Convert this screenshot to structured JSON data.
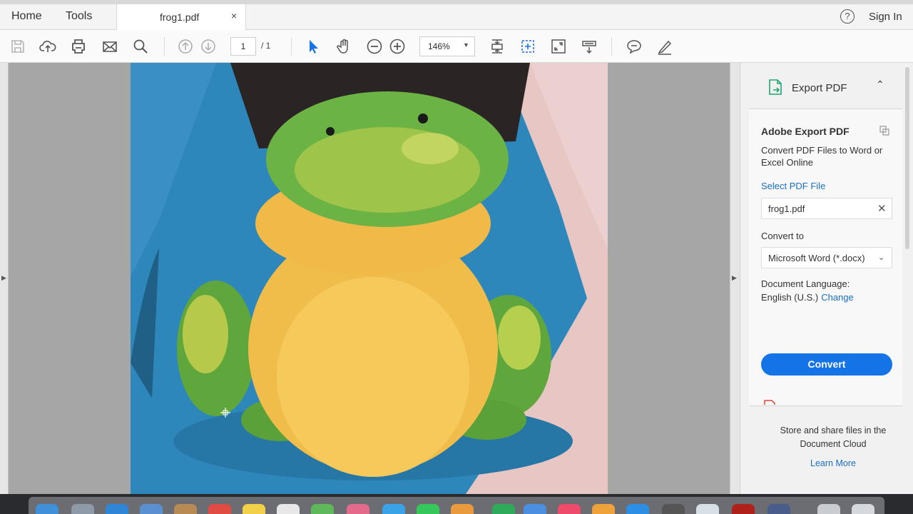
{
  "menubar": {
    "home_label": "Home",
    "tools_label": "Tools",
    "help_glyph": "?",
    "signin_label": "Sign In"
  },
  "tab": {
    "filename": "frog1.pdf",
    "close_glyph": "×"
  },
  "toolbar": {
    "icons": [
      "save-icon",
      "upload-cloud-icon",
      "print-icon",
      "email-icon",
      "search-icon",
      "page-up-icon",
      "page-down-icon",
      "select-arrow-icon",
      "hand-icon",
      "zoom-out-icon",
      "zoom-in-icon",
      "fit-page-icon",
      "marquee-zoom-icon",
      "full-screen-icon",
      "read-mode-icon",
      "comment-icon",
      "sign-icon"
    ],
    "page_current": "1",
    "page_total": "/ 1",
    "zoom": "146%",
    "accent": "#1473e6"
  },
  "document": {
    "content": "photo of a green and yellow plush frog toy on a blue tray"
  },
  "panel": {
    "header_title": "Export PDF",
    "title": "Adobe Export PDF",
    "description": "Convert PDF Files to Word or Excel Online",
    "select_file_label": "Select PDF File",
    "file_value": "frog1.pdf",
    "convert_to_label": "Convert to",
    "convert_to_value": "Microsoft Word (*.docx)",
    "doc_lang_label": "Document Language:",
    "doc_lang_value": "English (U.S.)",
    "change_label": "Change",
    "convert_button": "Convert",
    "store_text": "Store and share files in the Document Cloud",
    "learn_more": "Learn More",
    "button_color": "#1473e6",
    "link_color": "#1a6fc4"
  }
}
